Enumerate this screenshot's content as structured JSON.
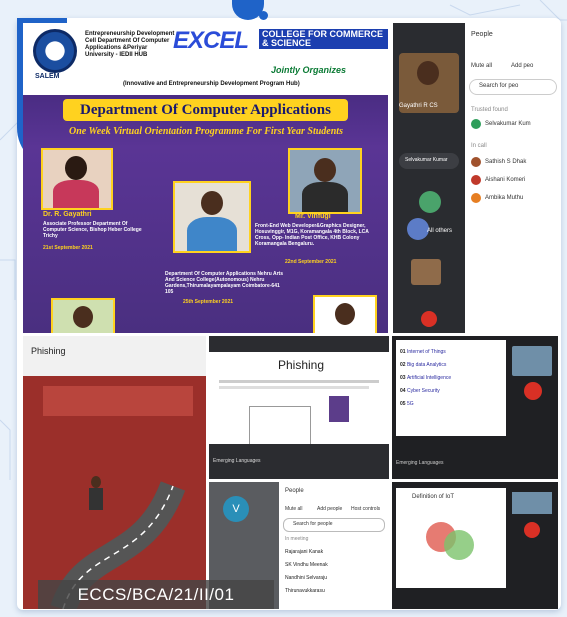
{
  "poster": {
    "logo_text": "SALEM",
    "cell_lines": "Entrepreneurship Development Cell Department Of Computer Applications &Periyar University - IEDII HUB",
    "brand": "EXCEL",
    "college": "COLLEGE FOR COMMERCE & SCIENCE",
    "jointly": "Jointly Organizes",
    "hub": "(Innovative and Entrepreneurship Development Program Hub)",
    "department": "Department Of Computer Applications",
    "program": "One Week Virtual Orientation Programme For First Year Students",
    "speaker1_name": "Dr. R. Gayathri",
    "speaker1_info": "Associate Professor Department Of Computer Science, Bishop Heber College Trichy",
    "speaker1_date": "21st September 2021",
    "speaker2_name": "Mr. Vinfugi",
    "speaker2_info": "Front-End Web Developer&Graphics Designer, Hosuvinggir, M1G, Koramangala 4th Block, LCA Cross, Opp- Indian Post Office, KHB Colony Koramangala Bengaluru.",
    "speaker2_date": "22nd September 2021",
    "speaker3_info": "Department Of Computer Applications Nehru Arts And Science College(Autonomous) Nehru Gardens,Thirumalayampalayam Coimbatore-641 105",
    "speaker3_date": "25th September 2021"
  },
  "meet_people": {
    "title": "People",
    "mute": "Mute all",
    "add": "Add peo",
    "search": "Search for peo",
    "section": "Trusted found",
    "participant1": "Selvakumar Kum",
    "section2": "In call",
    "participant2": "Sathish S Dhak",
    "participant3": "Aishani Komeri",
    "participant4": "Ambika Muthu",
    "participant_host": "Selvakumar Kumar",
    "video_label": "Gayathri R CS",
    "all_others": "All others"
  },
  "slides": {
    "phishing_title": "Phishing",
    "slide_head": "Phishing",
    "topics": [
      {
        "num": "01",
        "label": "Internet of Things"
      },
      {
        "num": "02",
        "label": "Big data Analytics"
      },
      {
        "num": "03",
        "label": "Artificial Intelligence"
      },
      {
        "num": "04",
        "label": "Cyber Security"
      },
      {
        "num": "05",
        "label": "5G"
      }
    ],
    "footer_lang": "Emerging Languages",
    "iot_title": "Definition of IoT"
  },
  "bottom_people": {
    "title": "People",
    "mute": "Mute all",
    "add": "Add people",
    "host_controls": "Host controls",
    "search": "Search for people",
    "section": "In meeting",
    "names": [
      "Rajarajani Kanak",
      "SK Vindhu Meenak",
      "Nandhini Selvaraju",
      "Thirunavukkarasu"
    ]
  },
  "caption": "ECCS/BCA/21/II/01"
}
